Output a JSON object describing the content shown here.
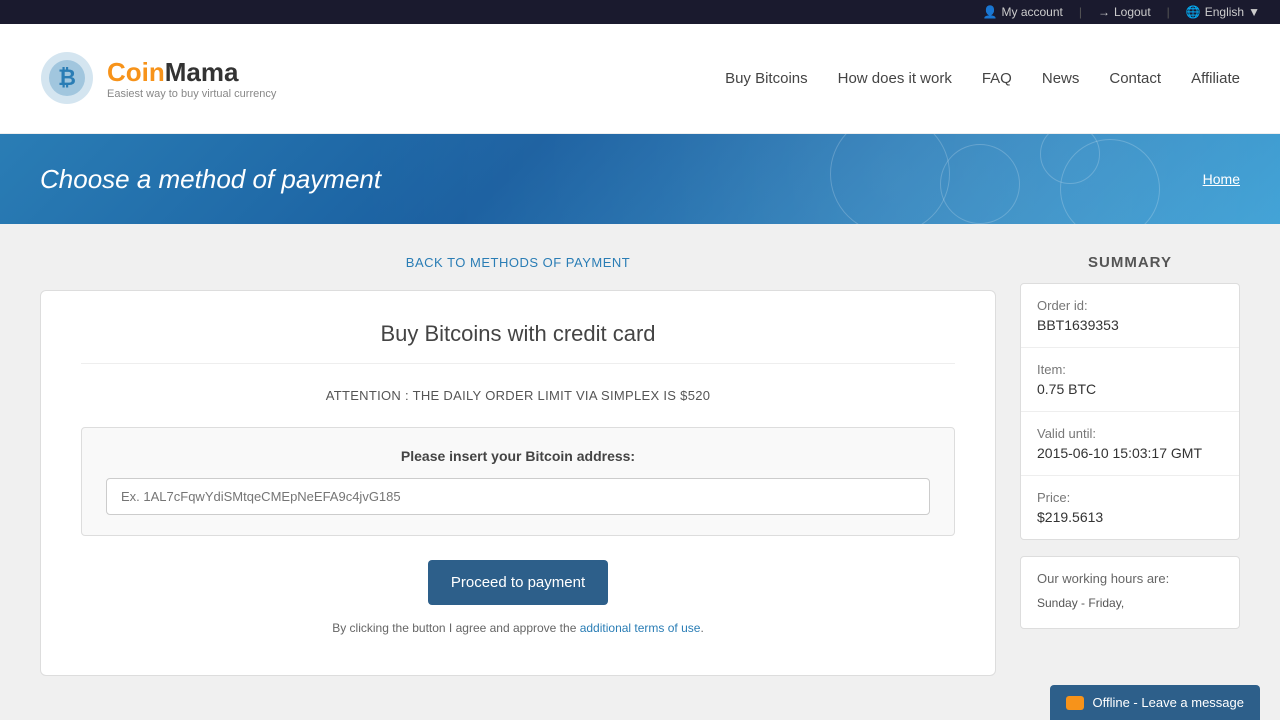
{
  "topbar": {
    "my_account": "My account",
    "logout": "Logout",
    "english": "English",
    "account_icon": "person-icon",
    "logout_icon": "logout-icon",
    "globe_icon": "globe-icon"
  },
  "header": {
    "logo_name": "CoinMama",
    "logo_tagline": "Easiest way to buy virtual currency",
    "nav": [
      {
        "label": "Buy Bitcoins",
        "id": "nav-buy-bitcoins"
      },
      {
        "label": "How does it work",
        "id": "nav-how-it-works"
      },
      {
        "label": "FAQ",
        "id": "nav-faq"
      },
      {
        "label": "News",
        "id": "nav-news"
      },
      {
        "label": "Contact",
        "id": "nav-contact"
      },
      {
        "label": "Affiliate",
        "id": "nav-affiliate"
      }
    ]
  },
  "hero": {
    "title": "Choose a method of payment",
    "breadcrumb": "Home"
  },
  "back_link": "BACK TO METHODS OF PAYMENT",
  "payment": {
    "title": "Buy Bitcoins with credit card",
    "attention": "ATTENTION : THE DAILY ORDER LIMIT VIA SIMPLEX IS $520",
    "address_label": "Please insert your Bitcoin address:",
    "address_placeholder": "Ex. 1AL7cFqwYdiSMtqeCMEpNeEFA9c4jvG185",
    "proceed_btn": "Proceed to payment",
    "terms_prefix": "By clicking the button I agree and approve the ",
    "terms_link": "additional terms of use",
    "terms_suffix": "."
  },
  "summary": {
    "title": "SUMMARY",
    "order_id_label": "Order id:",
    "order_id_value": "BBT1639353",
    "item_label": "Item:",
    "item_value": "0.75 BTC",
    "valid_until_label": "Valid until:",
    "valid_until_value": "2015-06-10 15:03:17 GMT",
    "price_label": "Price:",
    "price_value": "$219.5613",
    "working_hours_label": "Our working hours are:",
    "working_hours_row1": "Sunday - Friday,"
  },
  "chat": {
    "label": "Offline - Leave a message"
  }
}
